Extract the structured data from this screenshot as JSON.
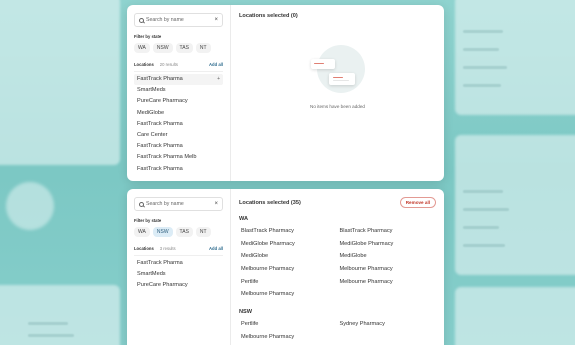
{
  "panel_top": {
    "search": {
      "placeholder": "Search by name"
    },
    "filter_title": "Filter by state",
    "states": [
      "WA",
      "NSW",
      "TAS",
      "NT"
    ],
    "locations_label": "Locations",
    "results": "20 results",
    "add_all": "Add all",
    "items": [
      "FastTrack Pharma",
      "SmartMeds",
      "PureCare Pharmacy",
      "MediGlobe",
      "FastTrack Pharma",
      "Care Center",
      "FastTrack Pharma",
      "FastTrack Pharma Melb",
      "FastTrack Pharma"
    ],
    "hover_plus": "+",
    "selected_title": "Locations selected (0)",
    "empty_msg": "No items have been added"
  },
  "panel_bottom": {
    "search": {
      "placeholder": "Search by name"
    },
    "filter_title": "Filter by state",
    "states": [
      "WA",
      "NSW",
      "TAS",
      "NT"
    ],
    "active_state": "NSW",
    "locations_label": "Locations",
    "results": "3 results",
    "add_all": "Add all",
    "items": [
      "FastTrack Pharma",
      "SmartMeds",
      "PureCare Pharmacy"
    ],
    "selected_title": "Locations selected (35)",
    "remove_all": "Remove all",
    "groups": [
      {
        "state": "WA",
        "items": [
          "BlastTrack Pharmacy",
          "BlastTrack Pharmacy",
          "MediGlobe Pharmacy",
          "MediGlobe Pharmacy",
          "MediGlobe",
          "MediGlobe",
          "Melbourne Pharmacy",
          "Melbourne Pharmacy",
          "Pertlife",
          "Melbourne Pharmacy",
          "Melbourne Pharmacy"
        ]
      },
      {
        "state": "NSW",
        "items": [
          "Pertlife",
          "Sydney Pharmacy",
          "Melbourne Pharmacy"
        ]
      }
    ]
  },
  "colors": {
    "background": "#8fd3cf",
    "accent": "#2b6a8d",
    "active_chip": "#dcecf6",
    "danger": "#c2392b"
  },
  "icons": [
    "search-icon",
    "clear-icon",
    "add-icon",
    "empty-state-illustration"
  ]
}
